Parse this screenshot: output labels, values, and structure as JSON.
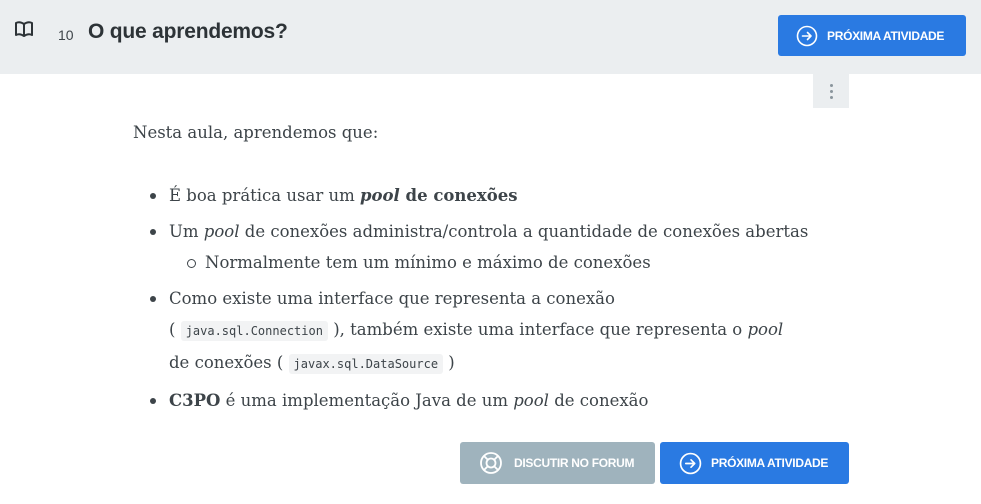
{
  "header": {
    "task_number": "10",
    "title": "O que aprendemos?",
    "next_button": "PRÓXIMA ATIVIDADE"
  },
  "content": {
    "intro": "Nesta aula, aprendemos que:",
    "bullet1": {
      "a": "É boa prática usar um ",
      "b": "pool",
      "c": " de conexões"
    },
    "bullet2": {
      "a": "Um ",
      "b": "pool",
      "c": " de conexões administra/controla a quantidade de conexões abertas"
    },
    "bullet2_sub": "Normalmente tem um mínimo e máximo de conexões",
    "bullet3": {
      "a": "Como existe uma interface que representa a conexão",
      "code1": "java.sql.Connection",
      "b": ", também existe uma interface que representa o ",
      "c": "pool",
      "d": "de conexões (",
      "code2": "javax.sql.DataSource",
      "e": ")"
    },
    "bullet4": {
      "a": "C3PO",
      "b": " é uma implementação Java de um ",
      "c": "pool",
      "d": " de conexão"
    }
  },
  "footer": {
    "forum_button": "DISCUTIR NO FORUM",
    "next_button": "PRÓXIMA ATIVIDADE"
  },
  "colors": {
    "primary": "#2a7ae2",
    "secondary": "#9fb3bd",
    "header_bg": "#ebeef0"
  }
}
